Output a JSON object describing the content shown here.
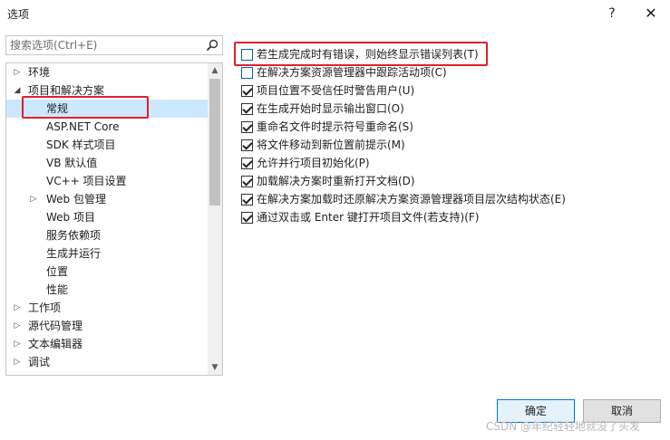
{
  "window": {
    "title": "选项",
    "help": "?",
    "close": "✕"
  },
  "search": {
    "placeholder": "搜索选项(Ctrl+E)",
    "value": ""
  },
  "tree": {
    "items": [
      {
        "label": "环境",
        "arrow": "▷",
        "level": 0
      },
      {
        "label": "项目和解决方案",
        "arrow": "◢",
        "level": 0
      },
      {
        "label": "常规",
        "arrow": "",
        "level": 1,
        "selected": true
      },
      {
        "label": "ASP.NET Core",
        "arrow": "",
        "level": 1
      },
      {
        "label": "SDK 样式项目",
        "arrow": "",
        "level": 1
      },
      {
        "label": "VB 默认值",
        "arrow": "",
        "level": 1
      },
      {
        "label": "VC++ 项目设置",
        "arrow": "",
        "level": 1
      },
      {
        "label": "Web 包管理",
        "arrow": "▷",
        "level": 1
      },
      {
        "label": "Web 项目",
        "arrow": "",
        "level": 1
      },
      {
        "label": "服务依赖项",
        "arrow": "",
        "level": 1
      },
      {
        "label": "生成并运行",
        "arrow": "",
        "level": 1
      },
      {
        "label": "位置",
        "arrow": "",
        "level": 1
      },
      {
        "label": "性能",
        "arrow": "",
        "level": 1
      },
      {
        "label": "工作项",
        "arrow": "▷",
        "level": 0
      },
      {
        "label": "源代码管理",
        "arrow": "▷",
        "level": 0
      },
      {
        "label": "文本编辑器",
        "arrow": "▷",
        "level": 0
      },
      {
        "label": "调试",
        "arrow": "▷",
        "level": 0
      }
    ]
  },
  "options": [
    {
      "label": "若生成完成时有错误，则始终显示错误列表(T)",
      "checked": false
    },
    {
      "label": "在解决方案资源管理器中跟踪活动项(C)",
      "checked": false
    },
    {
      "label": "项目位置不受信任时警告用户(U)",
      "checked": true
    },
    {
      "label": "在生成开始时显示输出窗口(O)",
      "checked": true
    },
    {
      "label": "重命名文件时提示符号重命名(S)",
      "checked": true
    },
    {
      "label": "将文件移动到新位置前提示(M)",
      "checked": true
    },
    {
      "label": "允许并行项目初始化(P)",
      "checked": true
    },
    {
      "label": "加载解决方案时重新打开文档(D)",
      "checked": true
    },
    {
      "label": "在解决方案加载时还原解决方案资源管理器项目层次结构状态(E)",
      "checked": true
    },
    {
      "label": "通过双击或 Enter 键打开项目文件(若支持)(F)",
      "checked": true
    }
  ],
  "buttons": {
    "ok": "确定",
    "cancel": "取消"
  },
  "watermark": "CSDN @年纪轻轻地就没了头发",
  "colors": {
    "highlight": "#e0202c",
    "selection": "#cce8ff",
    "primary_border": "#0078d7"
  }
}
